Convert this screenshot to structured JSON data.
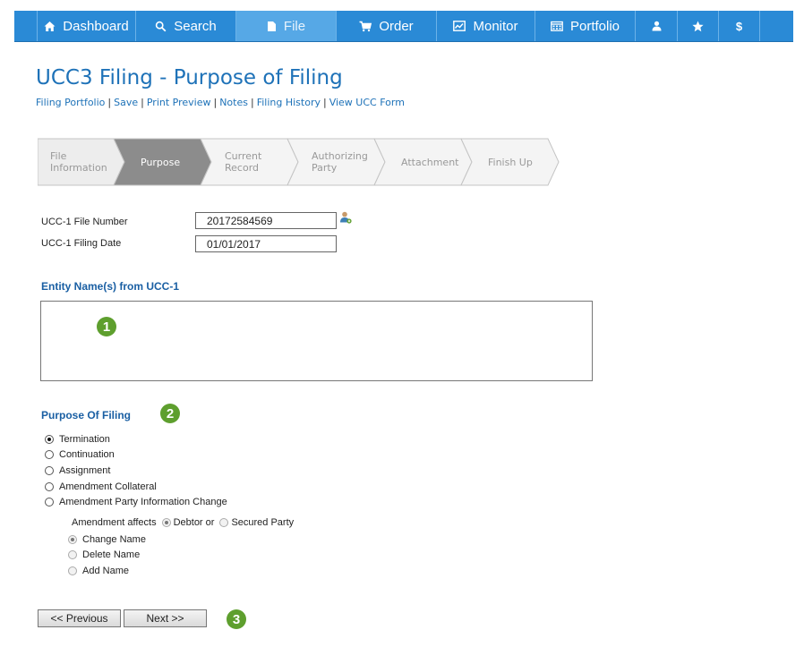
{
  "nav": {
    "items": [
      {
        "label": "Dashboard",
        "icon": "home-icon"
      },
      {
        "label": "Search",
        "icon": "search-icon"
      },
      {
        "label": "File",
        "icon": "file-icon",
        "active": true
      },
      {
        "label": "Order",
        "icon": "cart-icon"
      },
      {
        "label": "Monitor",
        "icon": "monitor-icon"
      },
      {
        "label": "Portfolio",
        "icon": "calendar-icon"
      },
      {
        "label": "",
        "icon": "user-icon"
      },
      {
        "label": "",
        "icon": "star-icon"
      },
      {
        "label": "",
        "icon": "dollar-icon"
      }
    ],
    "colors": {
      "bar": "#2a8ad6",
      "active": "#56a8e6"
    }
  },
  "page": {
    "title": "UCC3 Filing - Purpose of Filing",
    "links": [
      "Filing Portfolio",
      "Save",
      "Print Preview",
      "Notes",
      "Filing History",
      "View UCC Form"
    ],
    "link_separator": "|"
  },
  "wizard": {
    "steps": [
      {
        "lines": [
          "File",
          "Information"
        ],
        "state": "done"
      },
      {
        "lines": [
          "Purpose"
        ],
        "state": "active"
      },
      {
        "lines": [
          "Current",
          "Record"
        ],
        "state": "todo"
      },
      {
        "lines": [
          "Authorizing",
          "Party"
        ],
        "state": "todo"
      },
      {
        "lines": [
          "Attachment"
        ],
        "state": "todo"
      },
      {
        "lines": [
          "Finish Up"
        ],
        "state": "todo"
      }
    ],
    "colors": {
      "active_fill": "#8c8c8c",
      "done_fill": "#ededed",
      "todo_fill": "#f4f4f4",
      "active_text": "#ffffff",
      "text": "#999999"
    }
  },
  "fields": {
    "file_number": {
      "label": "UCC-1 File Number",
      "value": "20172584569"
    },
    "filing_date": {
      "label": "UCC-1 Filing Date",
      "value": "01/01/2017"
    }
  },
  "entity": {
    "title": "Entity Name(s) from UCC-1",
    "value": ""
  },
  "purpose": {
    "title": "Purpose Of Filing",
    "options": [
      {
        "label": "Termination",
        "checked": true
      },
      {
        "label": "Continuation",
        "checked": false
      },
      {
        "label": "Assignment",
        "checked": false
      },
      {
        "label": "Amendment Collateral",
        "checked": false
      },
      {
        "label": "Amendment Party Information Change",
        "checked": false
      }
    ],
    "amendment": {
      "affects_label": "Amendment affects",
      "debtor_label": "Debtor or",
      "secured_label": "Secured Party",
      "debtor_checked": true,
      "actions": [
        {
          "label": "Change Name",
          "checked": true
        },
        {
          "label": "Delete Name",
          "checked": false
        },
        {
          "label": "Add Name",
          "checked": false
        }
      ]
    }
  },
  "badges": [
    "1",
    "2",
    "3"
  ],
  "buttons": {
    "previous": "<< Previous",
    "next": "Next >>"
  },
  "colors": {
    "title": "#1e72b8",
    "section": "#1a5fa3",
    "badge": "#5e9f2e"
  }
}
